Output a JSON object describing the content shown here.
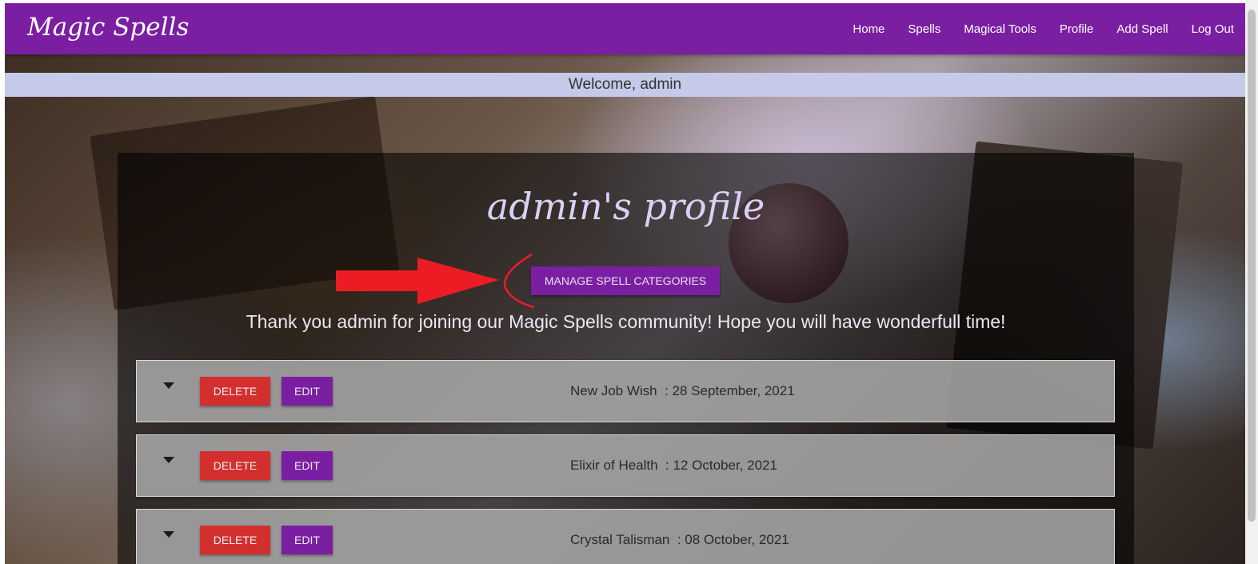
{
  "brand": "Magic Spells",
  "nav": [
    {
      "label": "Home"
    },
    {
      "label": "Spells"
    },
    {
      "label": "Magical Tools"
    },
    {
      "label": "Profile"
    },
    {
      "label": "Add Spell"
    },
    {
      "label": "Log Out"
    }
  ],
  "welcome": "Welcome, admin",
  "profile": {
    "title": "admin's profile",
    "manage_button": "MANAGE SPELL CATEGORIES",
    "thanks": "Thank you admin for joining our Magic Spells community! Hope you will have wonderfull time!"
  },
  "spells": [
    {
      "name": "New Job Wish",
      "date": "28 September, 2021"
    },
    {
      "name": "Elixir of Health",
      "date": "12 October, 2021"
    },
    {
      "name": "Crystal Talisman",
      "date": "08 October, 2021"
    }
  ],
  "row_buttons": {
    "delete": "DELETE",
    "edit": "EDIT"
  },
  "colors": {
    "primary": "#7b1fa2",
    "danger": "#d32f2f",
    "welcome_bar": "#c5cae9",
    "annotation": "#ed1c24"
  }
}
